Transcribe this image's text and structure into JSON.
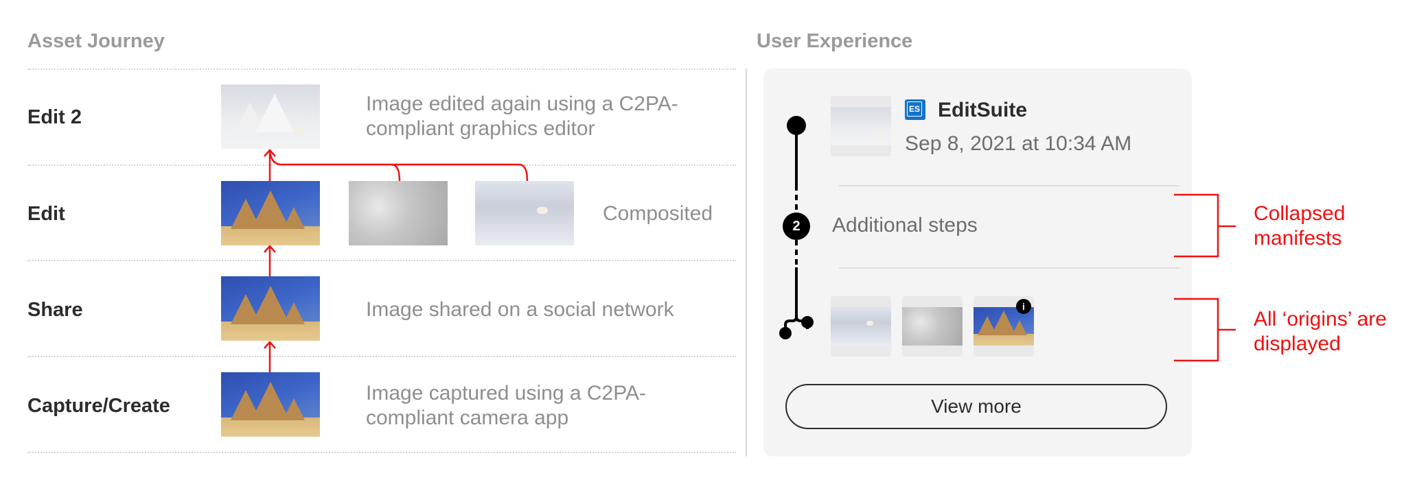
{
  "asset_journey": {
    "title": "Asset Journey",
    "rows": [
      {
        "label": "Edit 2",
        "description": "Image edited again using a C2PA-compliant graphics editor",
        "images": [
          "edited-pyramids-snow-bear"
        ]
      },
      {
        "label": "Edit",
        "description": "Composited",
        "images": [
          "pyramids",
          "snow",
          "polar-bear"
        ]
      },
      {
        "label": "Share",
        "description": "Image shared on a social network",
        "images": [
          "pyramids"
        ]
      },
      {
        "label": "Capture/Create",
        "description": "Image captured using a C2PA-compliant camera app",
        "images": [
          "pyramids"
        ]
      }
    ],
    "arrow_color": "#ee1111"
  },
  "user_experience": {
    "title": "User Experience",
    "latest": {
      "app_icon_text": "ES",
      "app_name": "EditSuite",
      "date": "Sep 8, 2021 at 10:34 AM",
      "app_icon_color": "#1473c9"
    },
    "collapsed": {
      "count": "2",
      "label": "Additional steps"
    },
    "origins": [
      "polar-bear",
      "snow",
      "pyramids"
    ],
    "origin_badge_icon": "info-icon",
    "view_more_label": "View more"
  },
  "annotations": {
    "collapsed": [
      "Collapsed",
      "manifests"
    ],
    "origins": [
      "All ‘origins’ are",
      "displayed"
    ],
    "color": "#ee1111"
  }
}
